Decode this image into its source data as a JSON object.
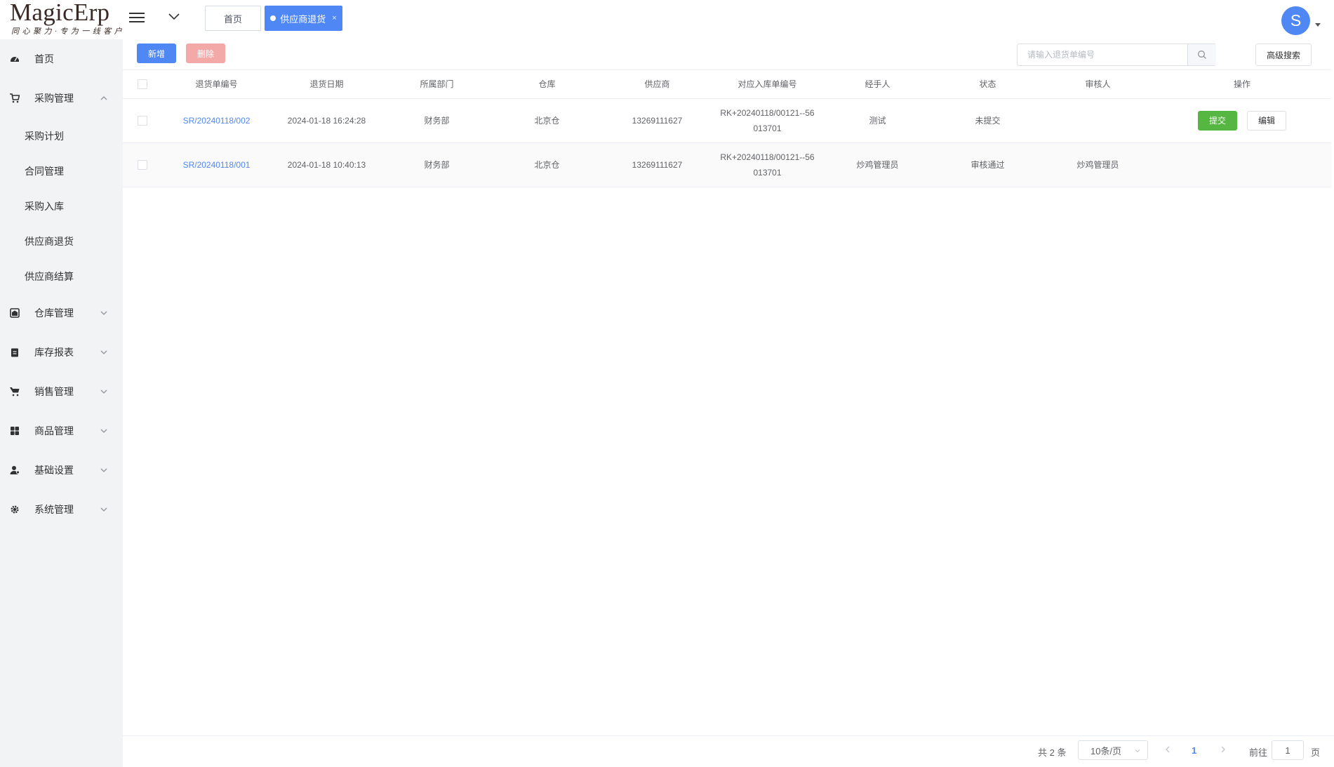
{
  "header": {
    "logo_text": "MagicErp",
    "logo_slogan": "同心聚力·专为一线客户",
    "tabs": [
      {
        "label": "首页"
      },
      {
        "label": "供应商退货",
        "close": "×"
      }
    ],
    "avatar_letter": "S"
  },
  "sidebar": {
    "home": "首页",
    "purchase": "采购管理",
    "purchase_children": [
      "采购计划",
      "合同管理",
      "采购入库",
      "供应商退货",
      "供应商结算"
    ],
    "warehouse": "仓库管理",
    "inventory_report": "库存报表",
    "sales": "销售管理",
    "goods": "商品管理",
    "basic_settings": "基础设置",
    "system": "系统管理"
  },
  "toolbar": {
    "add_label": "新增",
    "delete_label": "删除",
    "search_placeholder": "请输入退货单编号",
    "advanced_search_label": "高级搜索"
  },
  "table": {
    "columns": [
      "退货单编号",
      "退货日期",
      "所属部门",
      "仓库",
      "供应商",
      "对应入库单编号",
      "经手人",
      "状态",
      "审核人",
      "操作"
    ],
    "rows": [
      {
        "sn": "SR/20240118/002",
        "date": "2024-01-18 16:24:28",
        "dept": "财务部",
        "warehouse": "北京仓",
        "supplier": "13269111627",
        "inbound_sn_line1": "RK+20240118/00121--56",
        "inbound_sn_line2": "013701",
        "handler": "测试",
        "status": "未提交",
        "reviewer": "",
        "actions": [
          "提交",
          "编辑"
        ]
      },
      {
        "sn": "SR/20240118/001",
        "date": "2024-01-18 10:40:13",
        "dept": "财务部",
        "warehouse": "北京仓",
        "supplier": "13269111627",
        "inbound_sn_line1": "RK+20240118/00121--56",
        "inbound_sn_line2": "013701",
        "handler": "炒鸡管理员",
        "status": "审核通过",
        "reviewer": "炒鸡管理员",
        "actions": []
      }
    ]
  },
  "pagination": {
    "total": "共 2 条",
    "page_size": "10条/页",
    "current_page": "1",
    "goto_label": "前往",
    "goto_value": "1",
    "goto_suffix": "页"
  },
  "colors": {
    "primary": "#4f87f5",
    "success": "#55b642",
    "danger_disabled": "#f4a9a9",
    "sidebar_bg": "#f2f3f5"
  }
}
